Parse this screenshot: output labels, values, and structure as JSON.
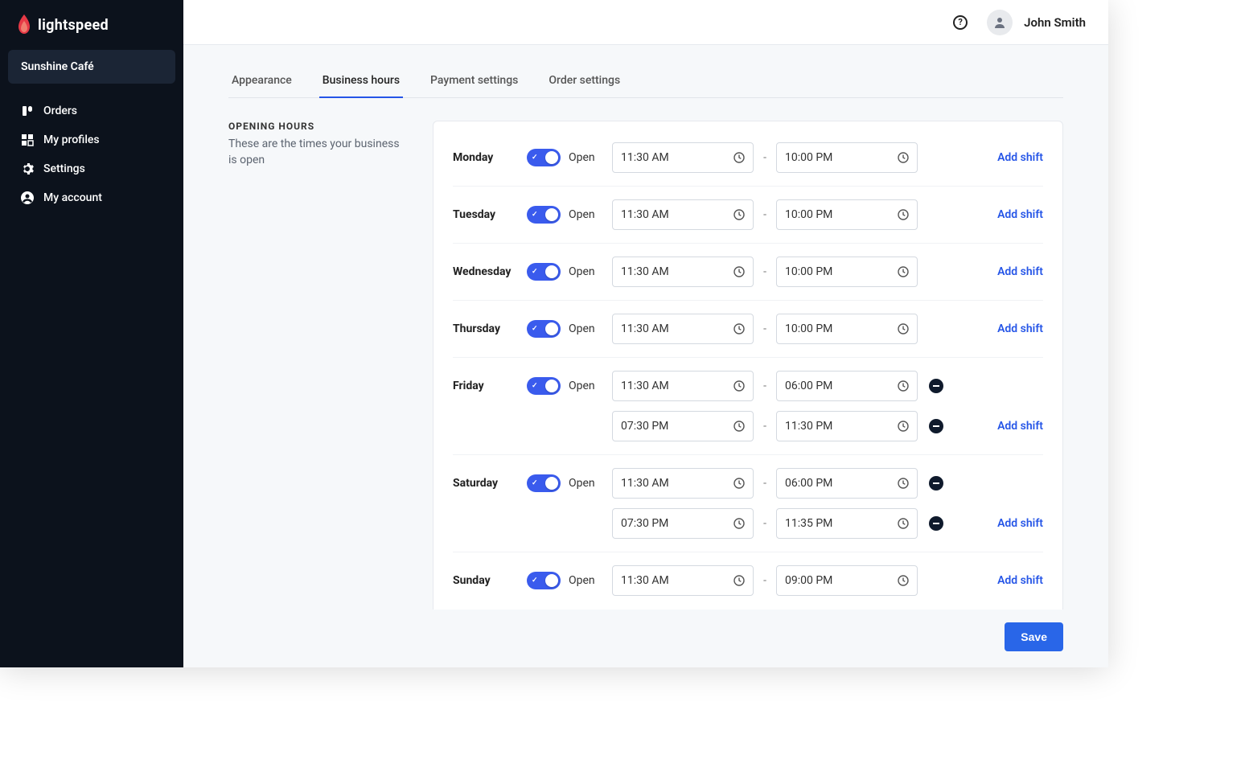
{
  "brand": {
    "name": "lightspeed"
  },
  "business": {
    "name": "Sunshine Café"
  },
  "nav": {
    "items": [
      {
        "label": "Orders"
      },
      {
        "label": "My profiles"
      },
      {
        "label": "Settings"
      },
      {
        "label": "My account"
      }
    ]
  },
  "header": {
    "user_name": "John Smith",
    "help_glyph": "?"
  },
  "tabs": [
    {
      "label": "Appearance",
      "active": false
    },
    {
      "label": "Business hours",
      "active": true
    },
    {
      "label": "Payment settings",
      "active": false
    },
    {
      "label": "Order settings",
      "active": false
    }
  ],
  "section": {
    "title": "OPENING HOURS",
    "subtitle": "These are the times your business is open"
  },
  "hours": {
    "open_label": "Open",
    "add_shift_label": "Add shift",
    "days": [
      {
        "name": "Monday",
        "open": true,
        "shifts": [
          {
            "from": "11:30 AM",
            "to": "10:00 PM"
          }
        ]
      },
      {
        "name": "Tuesday",
        "open": true,
        "shifts": [
          {
            "from": "11:30 AM",
            "to": "10:00 PM"
          }
        ]
      },
      {
        "name": "Wednesday",
        "open": true,
        "shifts": [
          {
            "from": "11:30 AM",
            "to": "10:00 PM"
          }
        ]
      },
      {
        "name": "Thursday",
        "open": true,
        "shifts": [
          {
            "from": "11:30 AM",
            "to": "10:00 PM"
          }
        ]
      },
      {
        "name": "Friday",
        "open": true,
        "shifts": [
          {
            "from": "11:30 AM",
            "to": "06:00 PM"
          },
          {
            "from": "07:30 PM",
            "to": "11:30 PM"
          }
        ]
      },
      {
        "name": "Saturday",
        "open": true,
        "shifts": [
          {
            "from": "11:30 AM",
            "to": "06:00 PM"
          },
          {
            "from": "07:30 PM",
            "to": "11:35 PM"
          }
        ]
      },
      {
        "name": "Sunday",
        "open": true,
        "shifts": [
          {
            "from": "11:30 AM",
            "to": "09:00 PM"
          }
        ]
      }
    ]
  },
  "footer": {
    "save_label": "Save"
  },
  "separator": "-"
}
